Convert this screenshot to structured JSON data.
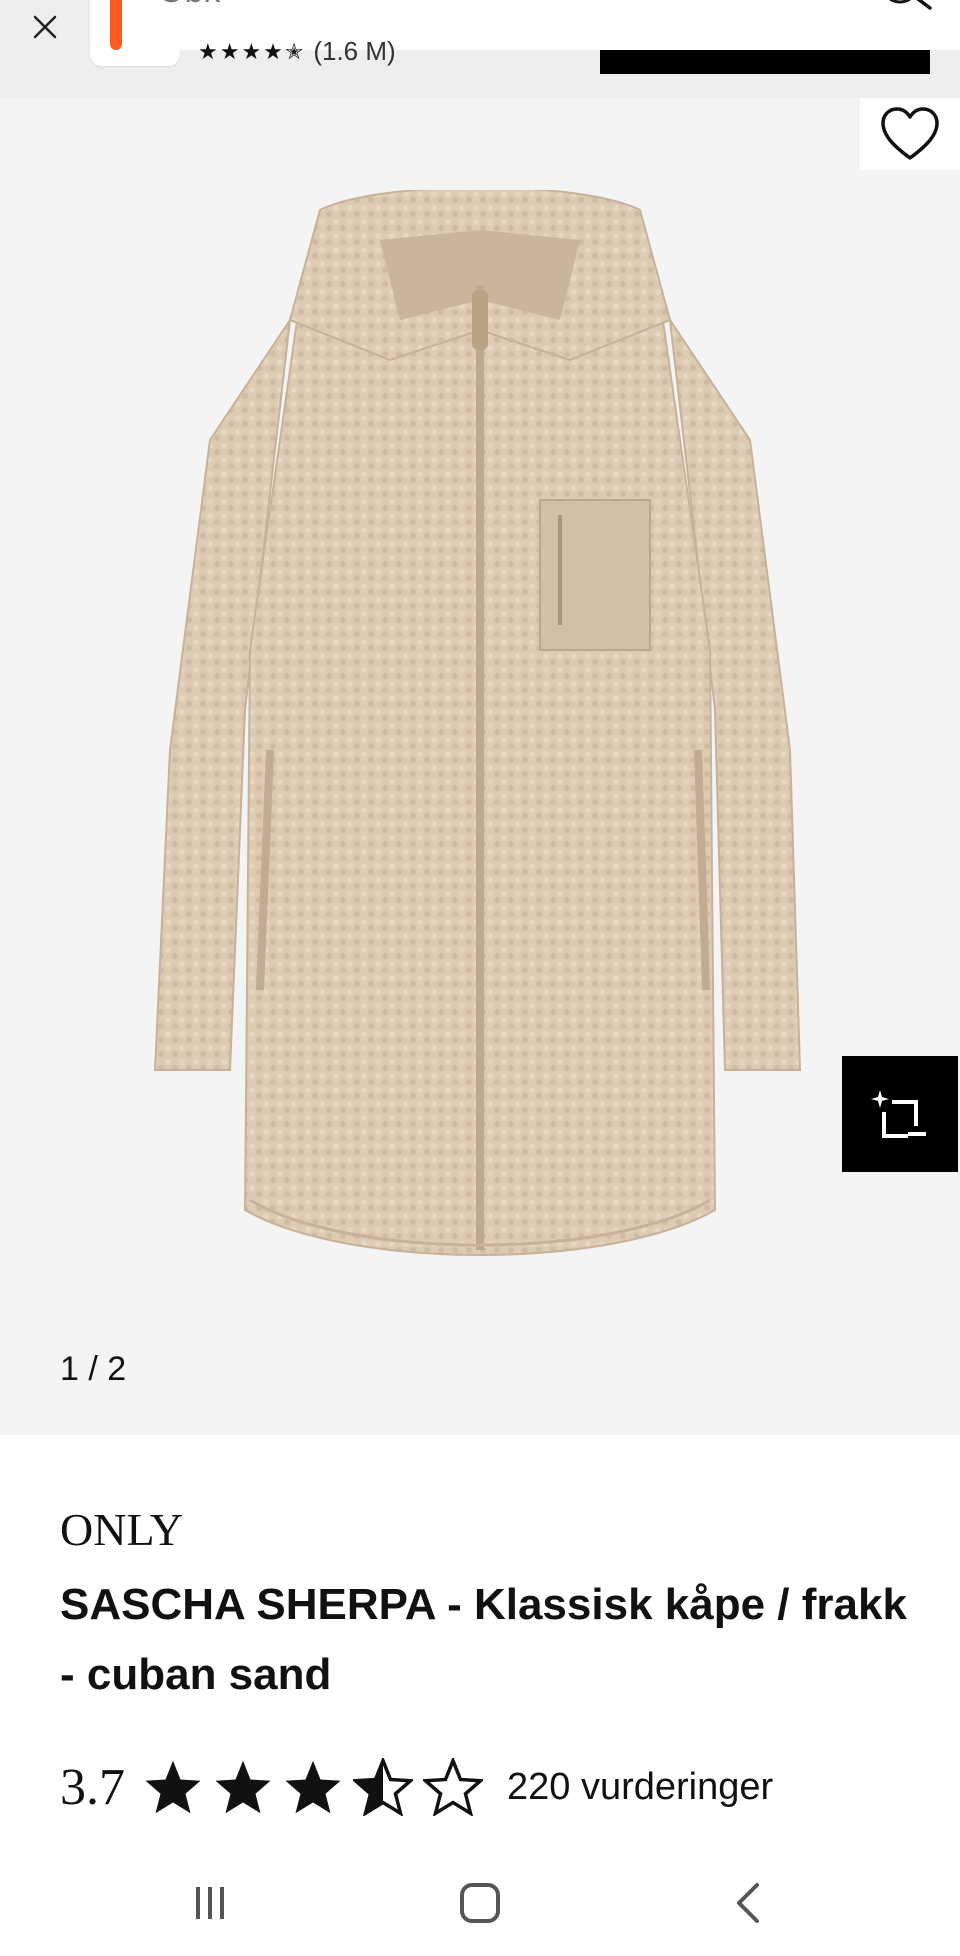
{
  "header": {
    "search_text": "Obk",
    "mini_rating_text": "(1.6 M)",
    "icons": {
      "close": "close-icon",
      "search": "search-icon"
    }
  },
  "gallery": {
    "counter": "1 / 2",
    "icons": {
      "favorite": "heart-icon",
      "camera": "camera-search-icon"
    },
    "product_image": "sherpa coat, cuban sand"
  },
  "product": {
    "brand": "ONLY",
    "title": "SASCHA SHERPA - Klassisk kåpe / frakk - cuban sand",
    "rating_value": "3.7",
    "rating": 3.5,
    "rating_max": 5,
    "rating_count": "220 vurderinger"
  },
  "nav": {
    "icons": {
      "recents": "recents-icon",
      "home": "home-icon",
      "back": "back-icon"
    }
  },
  "colors": {
    "accent_orange": "#ff5a1f",
    "gallery_bg": "#f4f4f4",
    "coat": "#dccab3"
  }
}
